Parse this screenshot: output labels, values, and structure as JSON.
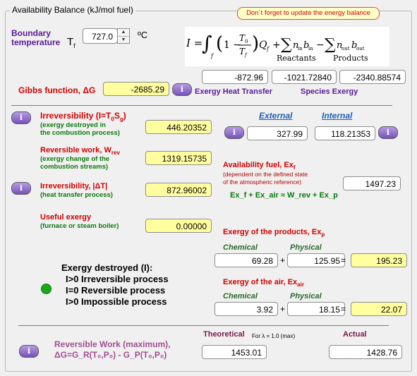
{
  "group_title": "Availability Balance (kJ/mol fuel)",
  "warning": "Don´t forget to update the energy balance",
  "boundary": {
    "label1": "Boundary",
    "label2": "temperature",
    "symbol": "T",
    "symbol_sub": "f",
    "value": "727.0",
    "unit": "ºC"
  },
  "formula": {
    "lhs": "I =",
    "reactants_label": "Reactants",
    "products_label": "Products"
  },
  "exergy_heat": {
    "value": "-872.96",
    "label": "Exergy Heat Transfer"
  },
  "species": {
    "reactants_value": "-1021.72840",
    "products_value": "-2340.88574",
    "label": "Species Exergy"
  },
  "gibbs": {
    "label": "Gibbs function, ΔG",
    "value": "-2685.29"
  },
  "irreversibility": {
    "title": "Irreversibility (I=T₀S_g)",
    "title_main": "Irreversibility (I=T",
    "title_sub1": "0",
    "title_mid": "S",
    "title_sub2": "g",
    "title_end": ")",
    "note1": "(exergy destroyed in",
    "note2": "the combustion process)",
    "value": "446.20352"
  },
  "external_internal": {
    "external_label": "External",
    "internal_label": "Internal",
    "external_value": "327.99",
    "internal_value": "118.21353"
  },
  "reversible_work": {
    "title": "Reversible work, W",
    "title_sub": "rev",
    "note1": "(exergy change of the",
    "note2": "combustion streams)",
    "value": "1319.15735"
  },
  "availability_fuel": {
    "title": "Availability fuel, Ex",
    "title_sub": "f",
    "note1": "(dependent on the defined state",
    "note2": "of the atmospheric reference)",
    "value": "1497.23",
    "equation": "Ex_f + Ex_air ≈ W_rev + Ex_p"
  },
  "irr_heat": {
    "title": "Irreversibility, |ΔT|",
    "note": "(heat transfer process)",
    "value": "872.96002"
  },
  "useful": {
    "title": "Useful exergy",
    "note": "(furnace or steam boiler)",
    "value": "0.00000"
  },
  "products": {
    "title": "Exergy of the products, Ex",
    "title_sub": "p",
    "chemical_label": "Chemical",
    "physical_label": "Physical",
    "chemical": "69.28",
    "physical": "125.95",
    "total": "195.23"
  },
  "air": {
    "title": "Exergy of the air, Ex",
    "title_sub": "air",
    "chemical_label": "Chemical",
    "physical_label": "Physical",
    "chemical": "3.92",
    "physical": "18.15",
    "total": "22.07"
  },
  "destroyed": {
    "title": "Exergy destroyed (I):",
    "line1": "I>0 Irreversible process",
    "line2": "I=0 Reversible process",
    "line3": "I>0 Impossible process",
    "status_color": "#1aa81a"
  },
  "rev_max": {
    "title": "Reversible Work (maximum),",
    "formula": "ΔG=G_R(T₀,P₀) - G_P(T₀,P₀)",
    "theoretical_label": "Theoretical",
    "lambda_note": "For λ = 1.0 (max)",
    "actual_label": "Actual",
    "theoretical_value": "1453.01",
    "actual_value": "1428.76"
  },
  "op_plus": "+",
  "op_equals": "=",
  "info_glyph": "i"
}
